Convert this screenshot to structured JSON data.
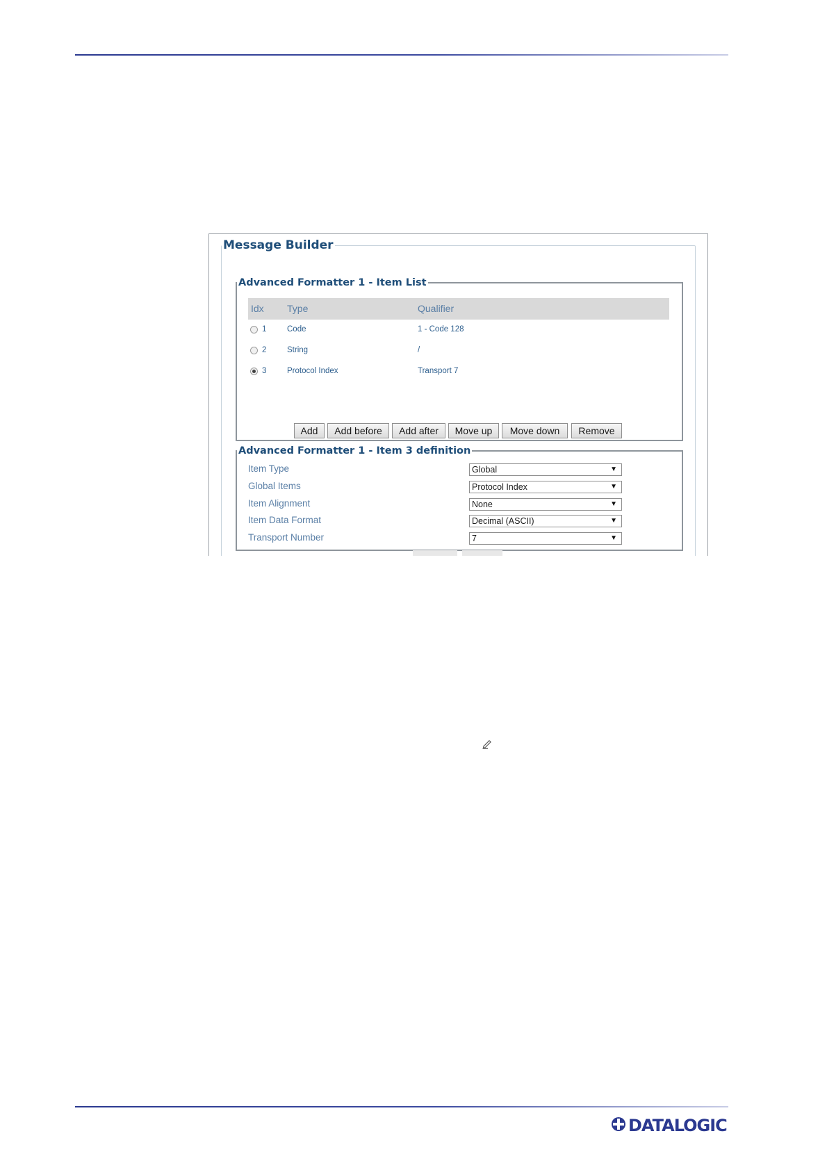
{
  "screenshot": {
    "panel_title": "Message Builder",
    "item_list": {
      "legend": "Advanced Formatter 1 - Item List",
      "columns": [
        "Idx",
        "Type",
        "Qualifier"
      ],
      "rows": [
        {
          "idx": "1",
          "type": "Code",
          "qualifier": "1 - Code 128",
          "selected": false
        },
        {
          "idx": "2",
          "type": "String",
          "qualifier": "/",
          "selected": false
        },
        {
          "idx": "3",
          "type": "Protocol Index",
          "qualifier": "Transport 7",
          "selected": true
        }
      ],
      "buttons": [
        "Add",
        "Add before",
        "Add after",
        "Move up",
        "Move down",
        "Remove"
      ]
    },
    "item_definition": {
      "legend": "Advanced Formatter 1 - Item 3 definition",
      "fields": [
        {
          "label": "Item Type",
          "value": "Global"
        },
        {
          "label": "Global Items",
          "value": "Protocol Index"
        },
        {
          "label": "Item Alignment",
          "value": "None"
        },
        {
          "label": "Item Data Format",
          "value": "Decimal (ASCII)"
        },
        {
          "label": "Transport Number",
          "value": "7"
        }
      ]
    }
  },
  "icons": {
    "edit": "pencil-icon"
  },
  "brand": {
    "logo_text": "DATALOGIC",
    "color": "#2b3990"
  }
}
